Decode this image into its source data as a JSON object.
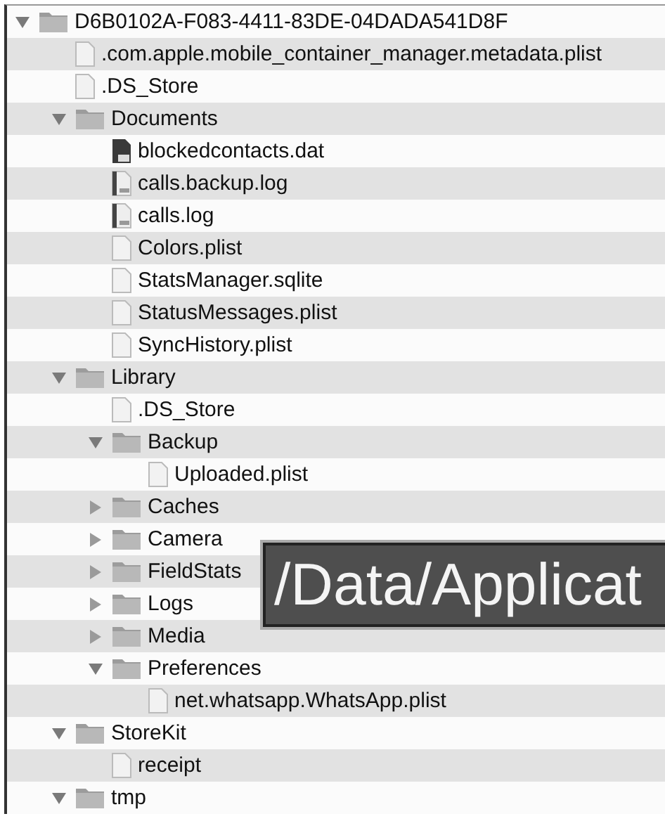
{
  "tree": [
    {
      "name": "D6B0102A-F083-4411-83DE-04DADA541D8F",
      "kind": "folder",
      "expanded": true,
      "children": [
        {
          "name": ".com.apple.mobile_container_manager.metadata.plist",
          "kind": "document"
        },
        {
          "name": ".DS_Store",
          "kind": "document"
        },
        {
          "name": "Documents",
          "kind": "folder",
          "expanded": true,
          "children": [
            {
              "name": "blockedcontacts.dat",
              "kind": "data"
            },
            {
              "name": "calls.backup.log",
              "kind": "log"
            },
            {
              "name": "calls.log",
              "kind": "log"
            },
            {
              "name": "Colors.plist",
              "kind": "document"
            },
            {
              "name": "StatsManager.sqlite",
              "kind": "document"
            },
            {
              "name": "StatusMessages.plist",
              "kind": "document"
            },
            {
              "name": "SyncHistory.plist",
              "kind": "document"
            }
          ]
        },
        {
          "name": "Library",
          "kind": "folder",
          "expanded": true,
          "children": [
            {
              "name": ".DS_Store",
              "kind": "document"
            },
            {
              "name": "Backup",
              "kind": "folder",
              "expanded": true,
              "children": [
                {
                  "name": "Uploaded.plist",
                  "kind": "document"
                }
              ]
            },
            {
              "name": "Caches",
              "kind": "folder",
              "expanded": false
            },
            {
              "name": "Camera",
              "kind": "folder",
              "expanded": false
            },
            {
              "name": "FieldStats",
              "kind": "folder",
              "expanded": false
            },
            {
              "name": "Logs",
              "kind": "folder",
              "expanded": false
            },
            {
              "name": "Media",
              "kind": "folder",
              "expanded": false
            },
            {
              "name": "Preferences",
              "kind": "folder",
              "expanded": true,
              "children": [
                {
                  "name": "net.whatsapp.WhatsApp.plist",
                  "kind": "document"
                }
              ]
            }
          ]
        },
        {
          "name": "StoreKit",
          "kind": "folder",
          "expanded": true,
          "children": [
            {
              "name": "receipt",
              "kind": "document"
            }
          ]
        },
        {
          "name": "tmp",
          "kind": "folder",
          "expanded": true
        }
      ]
    }
  ],
  "overlay_caption": {
    "text": "/Data/Applicat"
  }
}
